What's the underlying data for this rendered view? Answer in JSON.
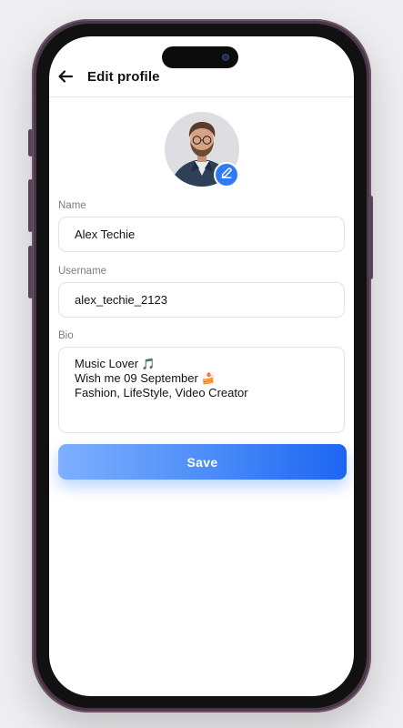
{
  "header": {
    "title": "Edit profile"
  },
  "form": {
    "name": {
      "label": "Name",
      "value": "Alex Techie"
    },
    "username": {
      "label": "Username",
      "value": "alex_techie_2123"
    },
    "bio": {
      "label": "Bio",
      "lines": [
        "Music Lover",
        "Wish me 09 September",
        "Fashion, LifeStyle, Video Creator"
      ],
      "emojis": [
        "🎵",
        "🍰"
      ]
    },
    "save_label": "Save"
  },
  "icons": {
    "back": "arrow-left-icon",
    "edit": "pencil-icon"
  },
  "colors": {
    "accent": "#2f7bf4",
    "save_gradient_start": "#7fb0ff",
    "save_gradient_end": "#1d66f2",
    "phone_frame": "#4a3747"
  }
}
